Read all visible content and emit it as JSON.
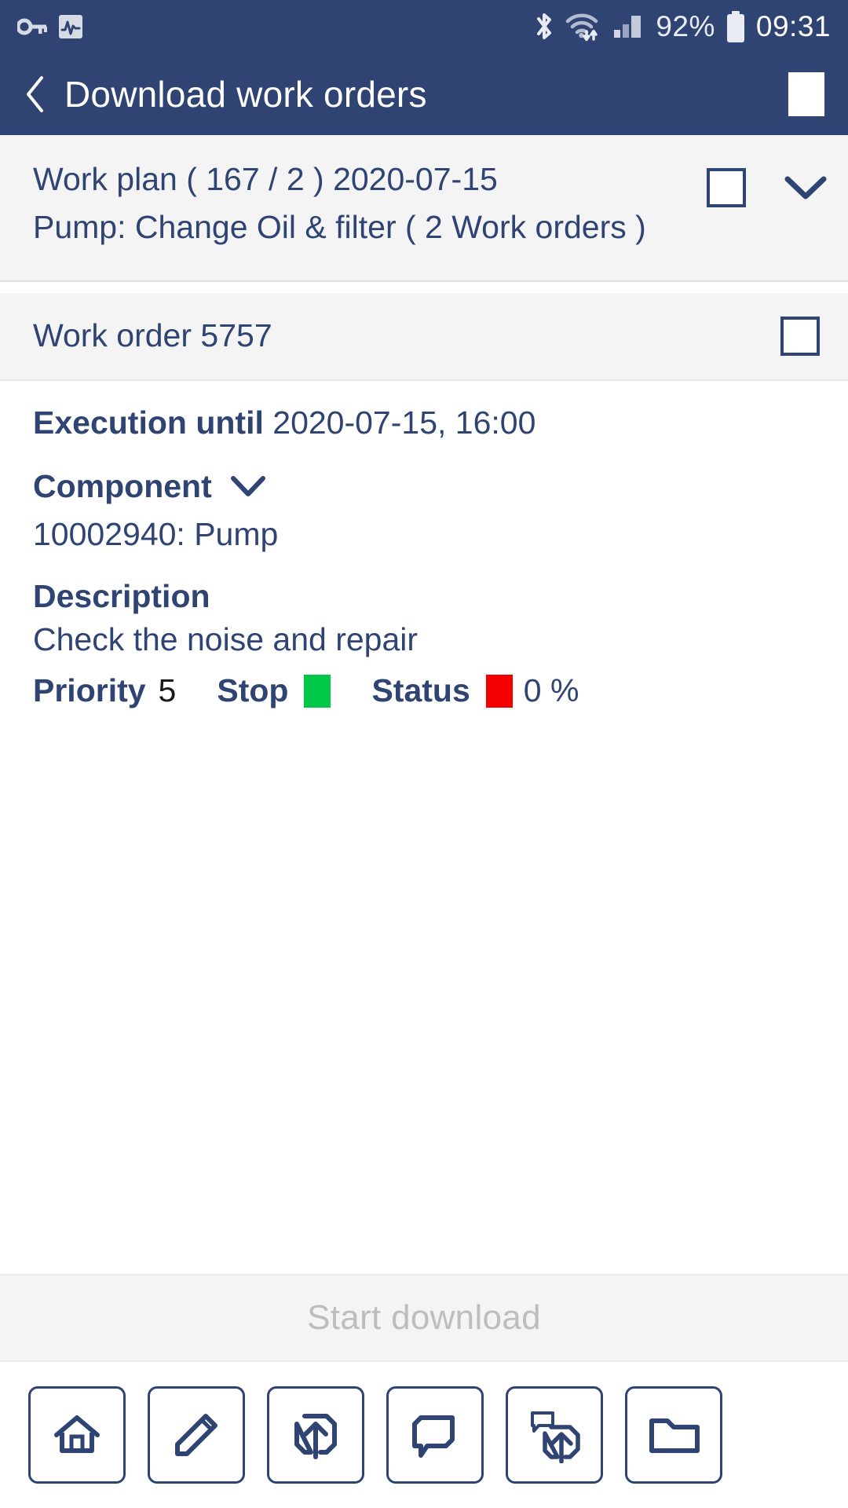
{
  "statusbar": {
    "icons": [
      "key-icon",
      "activity-icon",
      "bluetooth-icon",
      "wifi-icon",
      "signal-icon"
    ],
    "battery_percent": "92%",
    "time": "09:31"
  },
  "titlebar": {
    "back_label": "back-chevron",
    "title": "Download work orders",
    "action_square": "select-all-box"
  },
  "workplan": {
    "line1": "Work plan ( 167 / 2 ) 2020-07-15",
    "line2": "Pump: Change Oil & filter ( 2 Work orders )",
    "checkbox_checked": false,
    "expand_icon": "chevron-down-icon"
  },
  "workorder": {
    "title": "Work order 5757",
    "checkbox_checked": false,
    "execution_label": "Execution until",
    "execution_value": "2020-07-15, 16:00",
    "component_label": "Component",
    "component_value": "10002940: Pump",
    "description_label": "Description",
    "description_value": "Check the noise and repair",
    "priority_label": "Priority",
    "priority_value": "5",
    "stop_label": "Stop",
    "stop_color": "#00c846",
    "status_label": "Status",
    "status_color": "#f50000",
    "status_value": "0 %"
  },
  "footer": {
    "start_download_label": "Start download"
  },
  "toolbar": {
    "buttons": [
      {
        "name": "home-icon",
        "label": "Home"
      },
      {
        "name": "edit-pencil-icon",
        "label": "Edit"
      },
      {
        "name": "upload-icon",
        "label": "Upload"
      },
      {
        "name": "comment-icon",
        "label": "Comment"
      },
      {
        "name": "comment-upload-icon",
        "label": "Upload comment"
      },
      {
        "name": "folder-icon",
        "label": "Folder"
      }
    ]
  },
  "colors": {
    "header_blue": "#2f4472",
    "panel_grey": "#f4f4f5",
    "disabled_grey": "#bdbdbd",
    "green": "#00c846",
    "red": "#f50000"
  }
}
